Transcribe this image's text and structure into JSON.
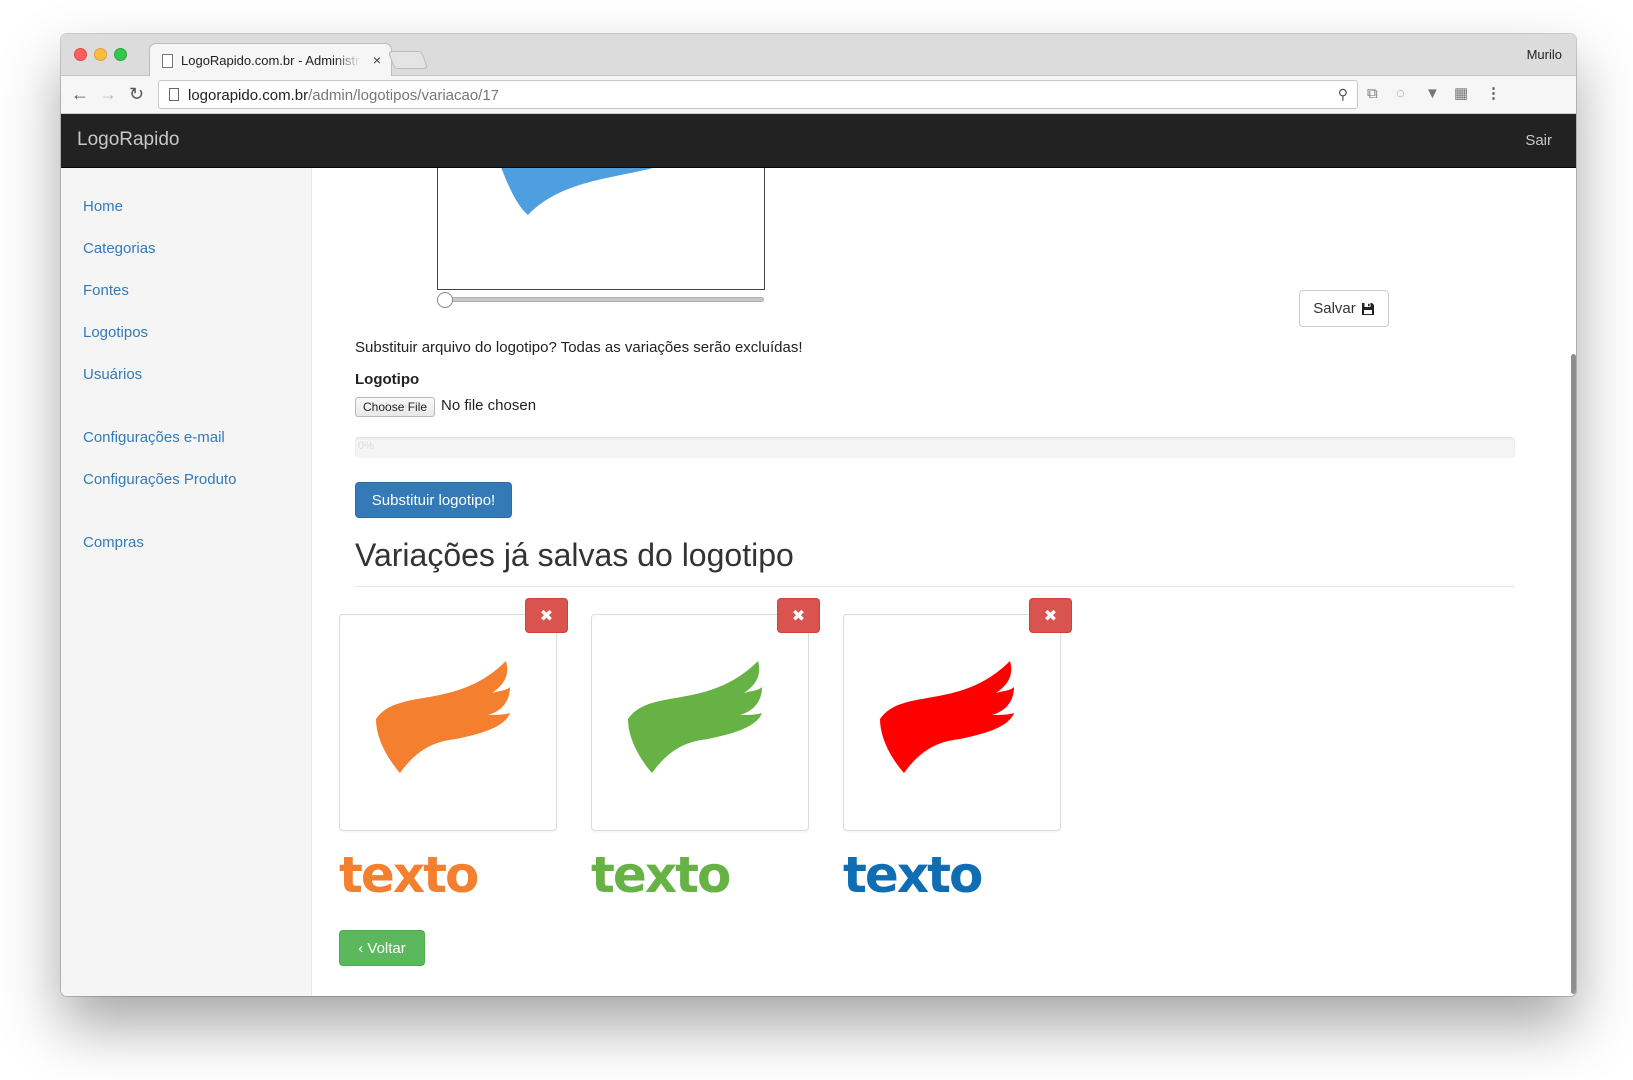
{
  "browser": {
    "tab_title": "LogoRapido.com.br - Administração",
    "profile_name": "Murilo",
    "url_host": "logorapido.com.br",
    "url_path": "/admin/logotipos/variacao/17"
  },
  "navbar": {
    "brand": "LogoRapido",
    "logout": "Sair"
  },
  "sidebar": {
    "items": [
      {
        "label": "Home"
      },
      {
        "label": "Categorias"
      },
      {
        "label": "Fontes"
      },
      {
        "label": "Logotipos"
      },
      {
        "label": "Usuários"
      },
      {
        "label": "Configurações e-mail"
      },
      {
        "label": "Configurações Produto"
      },
      {
        "label": "Compras"
      }
    ]
  },
  "editor": {
    "save_label": "Salvar",
    "zoom_slider_value": 0.0,
    "preview_color": "#4e9ee0"
  },
  "upload": {
    "warning": "Substituir arquivo do logotipo? Todas as variações serão excluídas!",
    "field_label": "Logotipo",
    "choose_file_label": "Choose File",
    "file_status": "No file chosen",
    "progress_label": "0%",
    "progress_value": 0,
    "submit_label": "Substituir logotipo!"
  },
  "variations": {
    "title": "Variações já salvas do logotipo",
    "delete_symbol": "✖",
    "items": [
      {
        "logo_color": "#f47f2f",
        "text": "texto",
        "text_color": "#f47f2f"
      },
      {
        "logo_color": "#66b245",
        "text": "texto",
        "text_color": "#66b245"
      },
      {
        "logo_color": "#ff0000",
        "text": "texto",
        "text_color": "#0f6db3"
      }
    ]
  },
  "footer": {
    "back_label": "Voltar"
  },
  "colors": {
    "primary": "#337ab7",
    "danger": "#d9534f",
    "success": "#5cb85c",
    "navbar": "#222222"
  }
}
